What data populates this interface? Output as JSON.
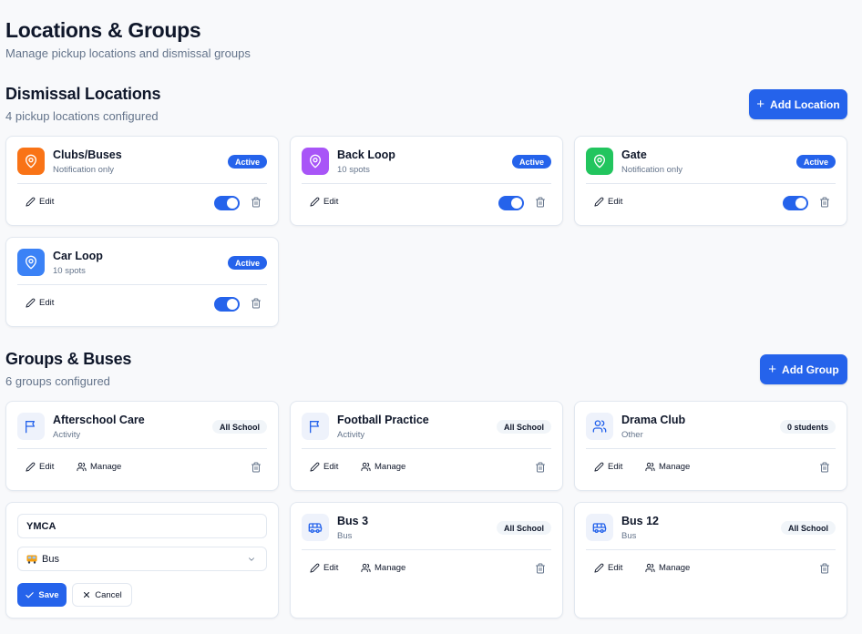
{
  "page": {
    "title": "Locations & Groups",
    "subtitle": "Manage pickup locations and dismissal groups"
  },
  "locations": {
    "title": "Dismissal Locations",
    "subtitle": "4 pickup locations configured",
    "add_label": "Add Location",
    "edit_label": "Edit",
    "items": [
      {
        "name": "Clubs/Buses",
        "meta": "Notification only",
        "status": "Active",
        "enabled": true,
        "color": "#f97316"
      },
      {
        "name": "Back Loop",
        "meta": "10 spots",
        "status": "Active",
        "enabled": true,
        "color": "#a855f7"
      },
      {
        "name": "Gate",
        "meta": "Notification only",
        "status": "Active",
        "enabled": true,
        "color": "#22c55e"
      },
      {
        "name": "Car Loop",
        "meta": "10 spots",
        "status": "Active",
        "enabled": true,
        "color": "#3b82f6"
      }
    ]
  },
  "groups": {
    "title": "Groups & Buses",
    "subtitle": "6 groups configured",
    "add_label": "Add Group",
    "edit_label": "Edit",
    "manage_label": "Manage",
    "items": [
      {
        "name": "Afterschool Care",
        "meta": "Activity",
        "badge": "All School",
        "icon": "flag-icon"
      },
      {
        "name": "Football Practice",
        "meta": "Activity",
        "badge": "All School",
        "icon": "flag-icon"
      },
      {
        "name": "Drama Club",
        "meta": "Other",
        "badge": "0 students",
        "icon": "users-icon"
      },
      {
        "name": "Bus 3",
        "meta": "Bus",
        "badge": "All School",
        "icon": "bus-icon"
      },
      {
        "name": "Bus 12",
        "meta": "Bus",
        "badge": "All School",
        "icon": "bus-icon"
      }
    ],
    "editing": {
      "name_value": "YMCA",
      "type_value": "Bus",
      "save_label": "Save",
      "cancel_label": "Cancel"
    }
  },
  "colors": {
    "accent": "#2563eb",
    "group_icon": "#2563eb"
  }
}
